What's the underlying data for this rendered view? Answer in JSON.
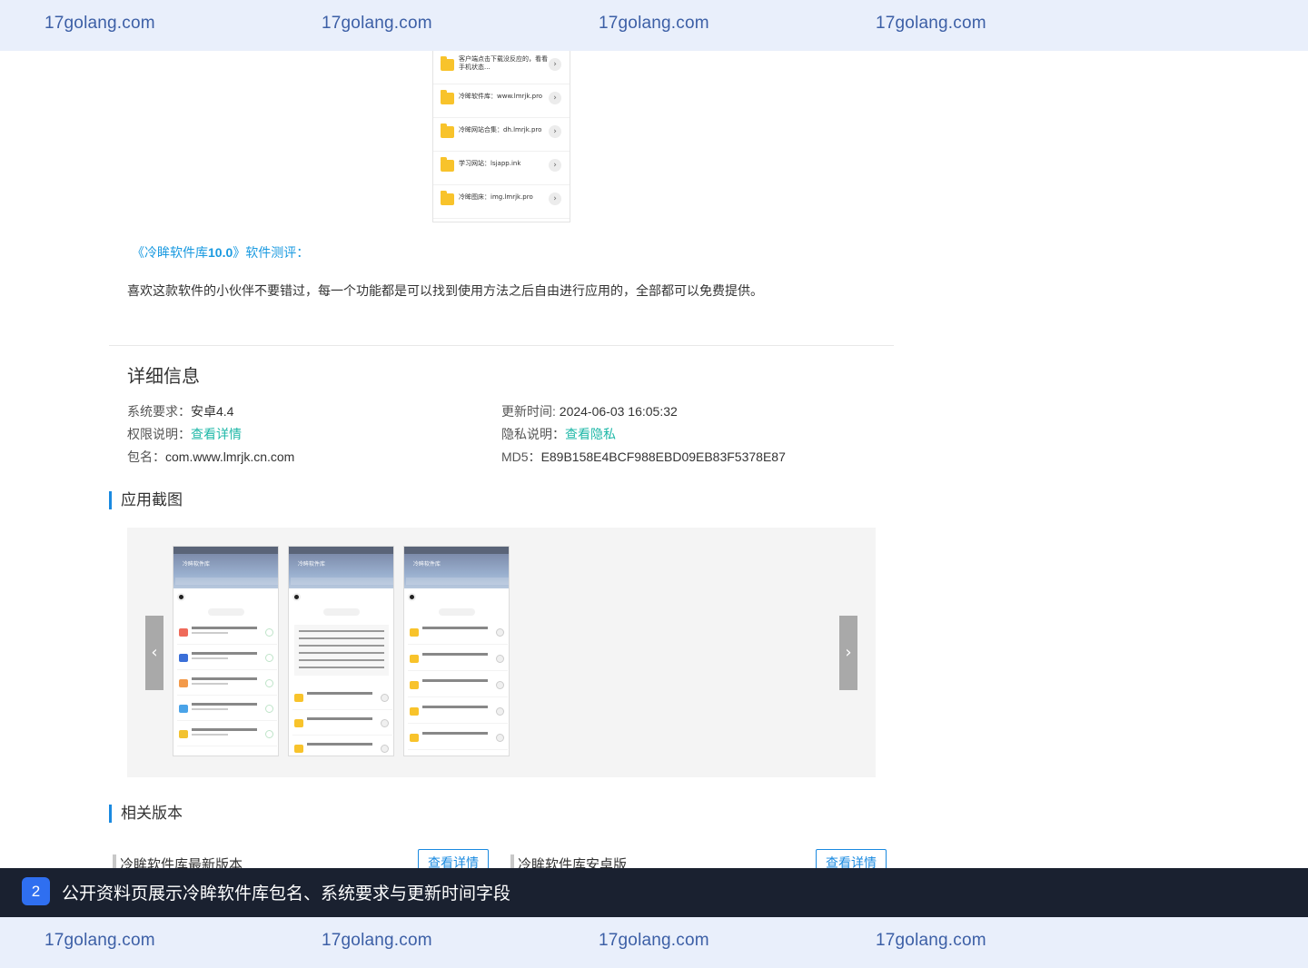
{
  "watermark": {
    "top": [
      "17golang.com",
      "17golang.com",
      "17golang.com",
      "17golang.com"
    ],
    "bottom": [
      "17golang.com",
      "17golang.com",
      "17golang.com",
      "17golang.com"
    ]
  },
  "phone_excerpt": {
    "items": [
      "客户端点击下载没反应的，看看手机状态...",
      "冷眸软件库：www.lmrjk.pro",
      "冷眸网站合集：dh.lmrjk.pro",
      "学习网站：lsjapp.ink",
      "冷眸图床：img.lmrjk.pro"
    ],
    "arrow_glyph": "›"
  },
  "review": {
    "title_prefix": "《冷眸软件库",
    "title_version": "10.0",
    "title_suffix": "》软件测评：",
    "body": "喜欢这款软件的小伙伴不要错过，每一个功能都是可以找到使用方法之后自由进行应用的，全部都可以免费提供。"
  },
  "details": {
    "title": "详细信息",
    "system_req_label": "系统要求：",
    "system_req_value": "安卓4.4",
    "update_time_label": "更新时间: ",
    "update_time_value": "2024-06-03 16:05:32",
    "permission_label": "权限说明：",
    "permission_link": "查看详情",
    "privacy_label": "隐私说明：",
    "privacy_link": "查看隐私",
    "package_label": "包名：",
    "package_value": "com.www.lmrjk.cn.com",
    "md5_label": "MD5：",
    "md5_value": "E89B158E4BCF988EBD09EB83F5378E87"
  },
  "screenshots": {
    "title": "应用截图",
    "prev_glyph": "‹",
    "next_glyph": "›",
    "shot_title": "冷眸软件库"
  },
  "related": {
    "title": "相关版本",
    "items": [
      {
        "name": "冷眸软件库最新版本",
        "button": "查看详情"
      },
      {
        "name": "冷眸软件库安卓版",
        "button": "查看详情"
      }
    ]
  },
  "caption": {
    "number": "2",
    "text": "公开资料页展示冷眸软件库包名、系统要求与更新时间字段"
  },
  "colors": {
    "link_blue": "#1a9ae0",
    "link_teal": "#1fb8a8",
    "accent": "#1a8ae0",
    "caption_bg": "#1a2130",
    "caption_badge": "#2f6ff0",
    "watermark_bg": "#e9effb"
  }
}
